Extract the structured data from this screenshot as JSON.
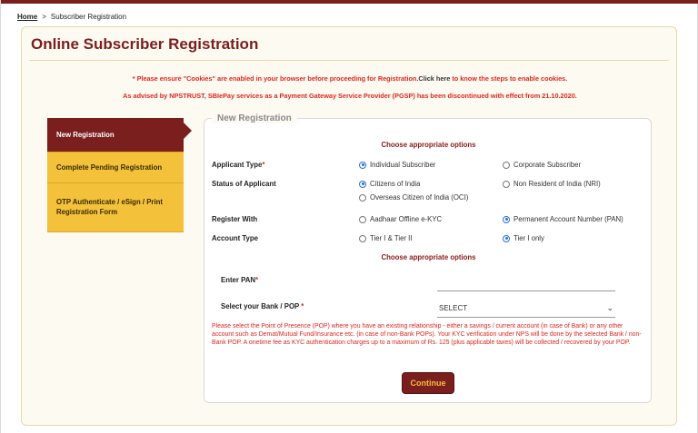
{
  "breadcrumb": {
    "home": "Home",
    "separator": ">",
    "current": "Subscriber Registration"
  },
  "page": {
    "title": "Online Subscriber Registration"
  },
  "notices": {
    "cookies_pre": "* Please ensure \"Cookies\" are enabled in your browser before proceeding for Registration.",
    "cookies_link": "Click here",
    "cookies_post": " to know the steps to enable cookies.",
    "sbi": "As advised by NPSTRUST, SBIePay services as a Payment Gateway Service Provider (PGSP) has been discontinued with effect from 21.10.2020."
  },
  "tabs": [
    {
      "label": "New Registration"
    },
    {
      "label": "Complete Pending Registration"
    },
    {
      "label": "OTP Authenticate / eSign / Print Registration Form"
    }
  ],
  "form": {
    "legend": "New Registration",
    "subhead1": "Choose appropriate options",
    "subhead2": "Choose appropriate options",
    "applicant_type": {
      "label": "Applicant Type",
      "required": "*",
      "options": [
        "Individual Subscriber",
        "Corporate Subscriber"
      ]
    },
    "status": {
      "label": "Status of Applicant",
      "options": [
        "Citizens of India",
        "Non Resident of India (NRI)",
        "Overseas Citizen of India (OCI)"
      ]
    },
    "register_with": {
      "label": "Register With",
      "options": [
        "Aadhaar Offline e-KYC",
        "Permanent Account Number (PAN)"
      ]
    },
    "account_type": {
      "label": "Account Type",
      "options": [
        "Tier I & Tier II",
        "Tier I only"
      ]
    },
    "pan": {
      "label": "Enter PAN",
      "required": "*",
      "value": ""
    },
    "bank": {
      "label": "Select your Bank / POP",
      "required": "*",
      "selected": "SELECT"
    },
    "help": "Please select the Point of Presence (POP) where you have an existing relationship - either a savings / current account (in case of Bank) or any other account such as Demat/Mutual Fund/Insurance etc. (in case of non-Bank POPs). Your KYC verification under NPS will be done by the selected Bank / non-Bank POP. A onetime fee as KYC authentication charges up to a maximum of Rs. 125 (plus applicable taxes) will be collected / recovered by your POP.",
    "continue_label": "Continue"
  },
  "colors": {
    "brand": "#7a1e1e",
    "accent": "#f3c13a",
    "alert": "#e0261f",
    "selected_radio": "#2a6fd6"
  }
}
